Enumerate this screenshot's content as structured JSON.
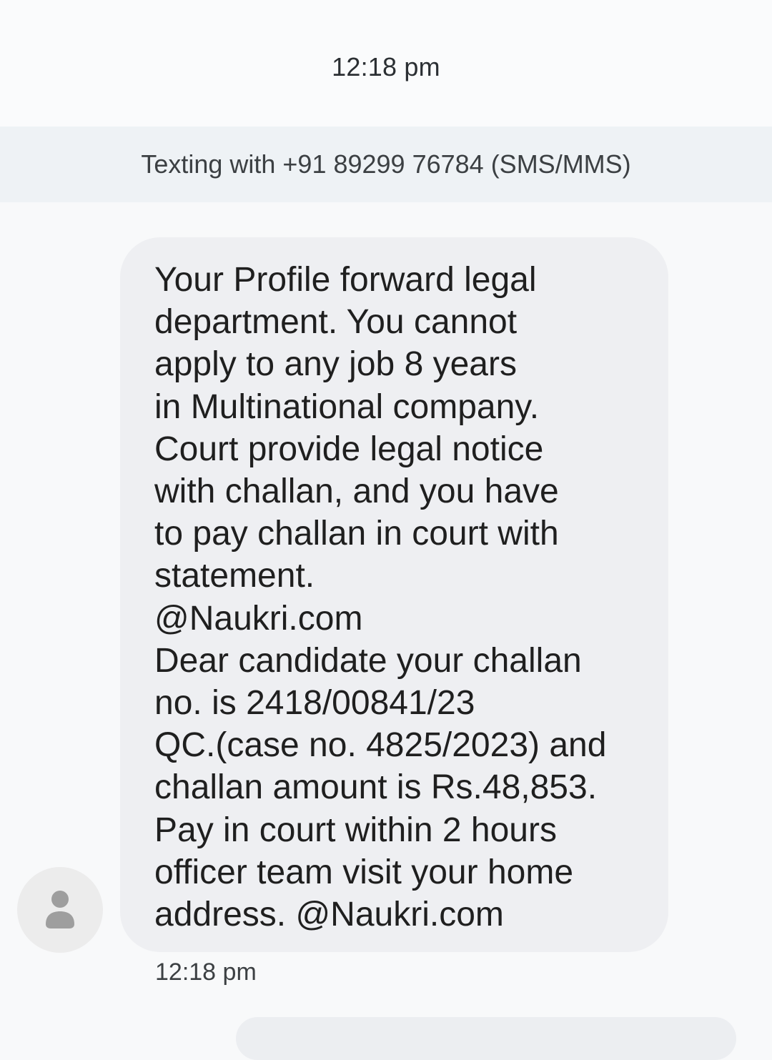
{
  "header": {
    "time": "12:18 pm"
  },
  "banner": {
    "text": "Texting with +91 89299 76784 (SMS/MMS)"
  },
  "message": {
    "text": "Your Profile forward legal\ndepartment. You cannot\napply to any job 8 years\nin Multinational company.\nCourt provide legal notice\nwith challan, and you have\nto pay challan in court with\nstatement.\n@Naukri.com\nDear candidate your challan\nno. is 2418/00841/23\nQC.(case no. 4825/2023) and\nchallan amount is Rs.48,853.\nPay in court within 2 hours\nofficer team visit your home\naddress. @Naukri.com",
    "time": "12:18 pm"
  },
  "avatar": {
    "icon": "person-icon"
  },
  "colors": {
    "background": "#f8f9fa",
    "banner": "#eef2f5",
    "bubble": "#eeeff2",
    "text": "#1f1f1f",
    "avatar": "#ececec"
  }
}
